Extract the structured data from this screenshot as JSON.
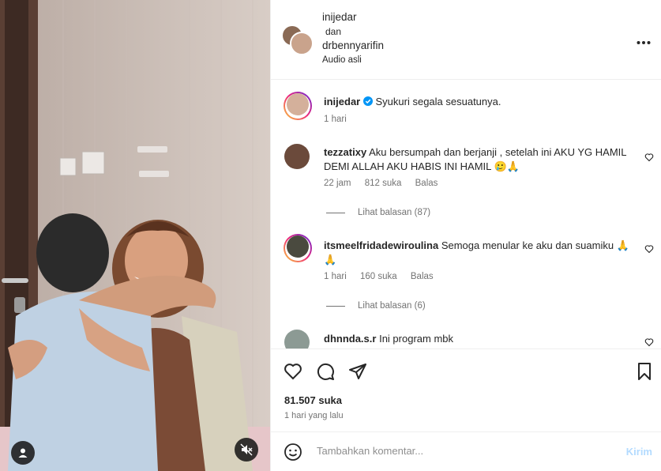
{
  "header": {
    "user1": "inijedar",
    "connector": "dan",
    "user2": "drbennyarifin",
    "audio": "Audio asli",
    "more_icon": "more-horizontal-icon"
  },
  "caption": {
    "username": "inijedar",
    "verified_icon": "verified-badge-icon",
    "text": "Syukuri segala sesuatunya.",
    "time": "1 hari"
  },
  "comments": [
    {
      "username": "tezzatixy",
      "text": "Aku bersumpah dan berjanji , setelah ini AKU YG HAMIL DEMI ALLAH AKU HABIS INI HAMIL 🥲🙏",
      "time": "22 jam",
      "likes": "812 suka",
      "reply": "Balas",
      "view_replies": "Lihat balasan (87)"
    },
    {
      "username": "itsmeelfridadewiroulina",
      "text": "Semoga menular ke aku dan suamiku 🙏🙏",
      "time": "1 hari",
      "likes": "160 suka",
      "reply": "Balas",
      "view_replies": "Lihat balasan (6)"
    },
    {
      "username": "dhnnda.s.r",
      "text": "Ini program mbk"
    }
  ],
  "actions": {
    "like_icon": "heart-icon",
    "comment_icon": "comment-icon",
    "share_icon": "share-icon",
    "save_icon": "bookmark-icon",
    "likes_count": "81.507 suka",
    "posted": "1 hari yang lalu"
  },
  "compose": {
    "emoji_icon": "emoji-icon",
    "placeholder": "Tambahkan komentar...",
    "post_label": "Kirim"
  },
  "media": {
    "tag_icon": "user-tag-icon",
    "mute_icon": "muted-speaker-icon"
  },
  "colors": {
    "text": "#262626",
    "secondary": "#737373",
    "verified": "#0095f6",
    "post_disabled": "#b3dbff"
  }
}
